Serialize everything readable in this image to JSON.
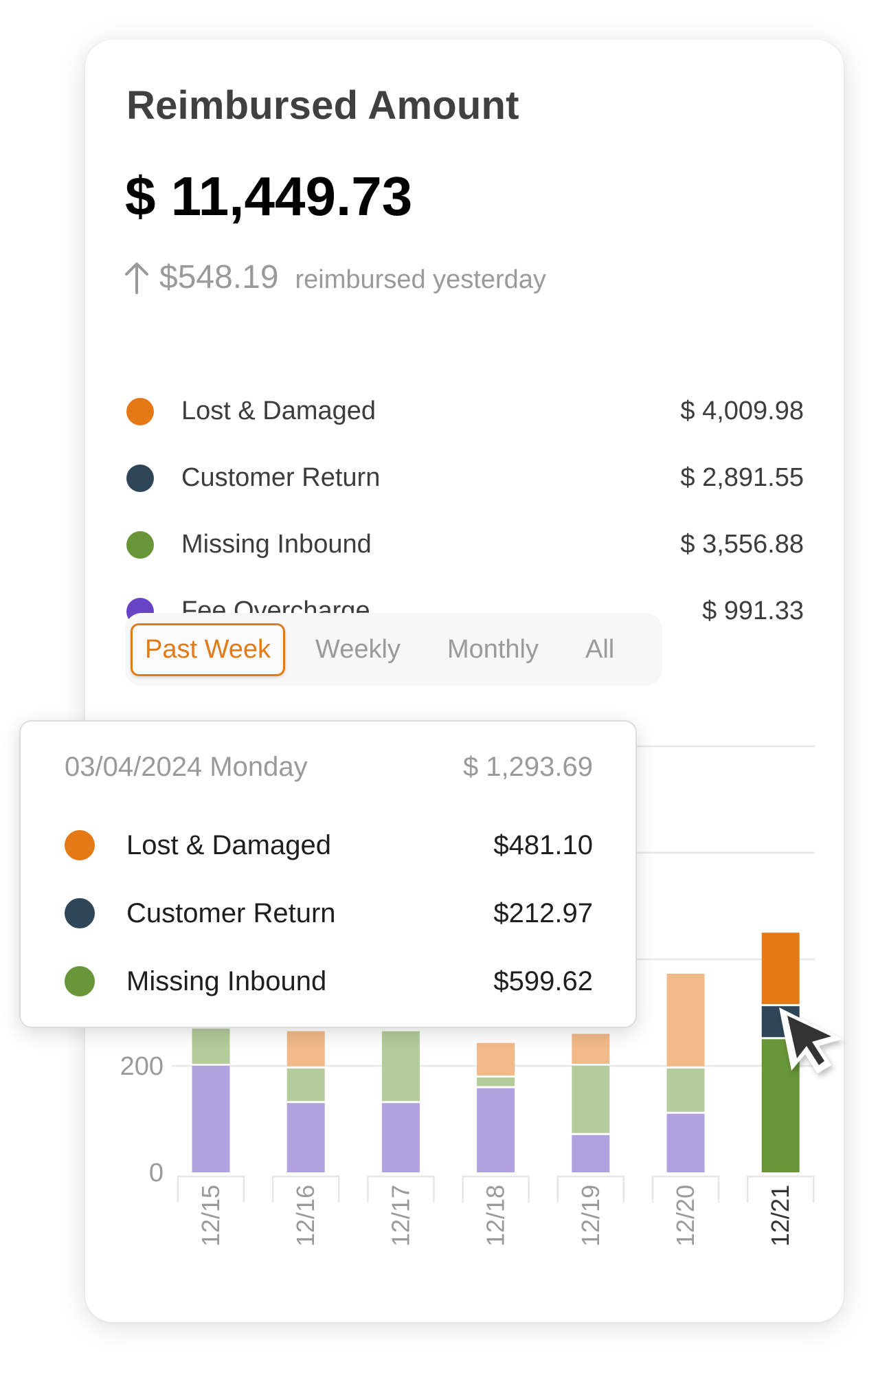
{
  "card": {
    "title": "Reimbursed Amount",
    "total": "$ 11,449.73",
    "delta": {
      "icon": "arrow-up-icon",
      "amount": "$548.19",
      "text": "reimbursed yesterday"
    }
  },
  "legend": [
    {
      "label": "Lost & Damaged",
      "value": "$ 4,009.98",
      "color": "#e47a16"
    },
    {
      "label": "Customer Return",
      "value": "$ 2,891.55",
      "color": "#2e4657"
    },
    {
      "label": "Missing Inbound",
      "value": "$ 3,556.88",
      "color": "#679537"
    },
    {
      "label": "Fee Overcharge",
      "value": "$ 991.33",
      "color": "#6744c6"
    }
  ],
  "tabs": [
    {
      "label": "Past Week",
      "active": true
    },
    {
      "label": "Weekly",
      "active": false
    },
    {
      "label": "Monthly",
      "active": false
    },
    {
      "label": "All",
      "active": false
    }
  ],
  "tooltip": {
    "date": "03/04/2024 Monday",
    "total": "$ 1,293.69",
    "rows": [
      {
        "label": "Lost & Damaged",
        "value": "$481.10",
        "color": "#e47a16"
      },
      {
        "label": "Customer Return",
        "value": "$212.97",
        "color": "#2e4657"
      },
      {
        "label": "Missing Inbound",
        "value": "$599.62",
        "color": "#679537"
      }
    ]
  },
  "chart_data": {
    "type": "bar",
    "stacked": true,
    "title": "",
    "xlabel": "",
    "ylabel": "",
    "categories": [
      "12/15",
      "12/16",
      "12/17",
      "12/18",
      "12/19",
      "12/20",
      "12/21"
    ],
    "highlighted_category": "12/21",
    "ylim": [
      0,
      800
    ],
    "yticks": [
      0,
      200,
      400,
      600,
      800
    ],
    "ytick_labels_visible": [
      "0",
      "200"
    ],
    "grid": true,
    "series": [
      {
        "name": "Fee Overcharge",
        "color": "#6744c6",
        "faded_color": "#b1a1df",
        "values": [
          200,
          130,
          130,
          158,
          70,
          110,
          0
        ]
      },
      {
        "name": "Missing Inbound",
        "color": "#679537",
        "faded_color": "#b4cc9b",
        "values": [
          70,
          65,
          135,
          20,
          130,
          85,
          250
        ]
      },
      {
        "name": "Customer Return",
        "color": "#2e4657",
        "faded_color": "#96a2ab",
        "values": [
          0,
          0,
          0,
          0,
          0,
          0,
          62
        ]
      },
      {
        "name": "Lost & Damaged",
        "color": "#e47a16",
        "faded_color": "#f2ba88",
        "values": [
          0,
          70,
          0,
          65,
          60,
          178,
          138
        ]
      }
    ]
  },
  "cursor": {
    "icon": "mouse-pointer-icon"
  }
}
